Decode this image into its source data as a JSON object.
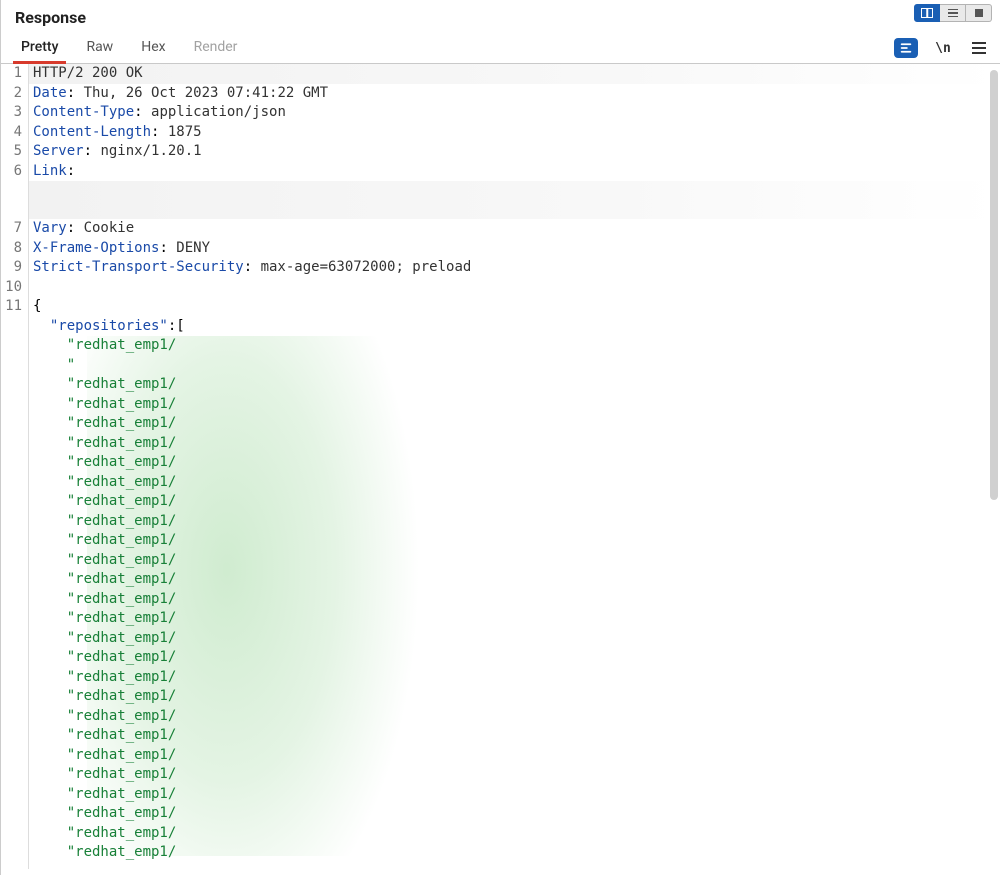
{
  "panel_title": "Response",
  "tabs": {
    "pretty": "Pretty",
    "raw": "Raw",
    "hex": "Hex",
    "render": "Render"
  },
  "toolbar": {
    "wrap_label": "\\n"
  },
  "gutter": [
    "1",
    "2",
    "3",
    "4",
    "5",
    "6",
    "",
    "7",
    "8",
    "9",
    "10",
    "11"
  ],
  "headers": {
    "status": "HTTP/2 200 OK",
    "date_k": "Date",
    "date_v": "Thu, 26 Oct 2023 07:41:22 GMT",
    "ctype_k": "Content-Type",
    "ctype_v": "application/json",
    "clen_k": "Content-Length",
    "clen_v": "1875",
    "server_k": "Server",
    "server_v": "nginx/1.20.1",
    "link_k": "Link",
    "link_v": "",
    "vary_k": "Vary",
    "vary_v": "Cookie",
    "xfo_k": "X-Frame-Options",
    "xfo_v": "DENY",
    "hsts_k": "Strict-Transport-Security",
    "hsts_v": "max-age=63072000; preload"
  },
  "body": {
    "open_brace": "{",
    "repos_key": "\"repositories\"",
    "open_arr": ":[",
    "items": [
      "\"redhat_emp1/",
      "\"",
      "\"redhat_emp1/",
      "\"redhat_emp1/",
      "\"redhat_emp1/",
      "\"redhat_emp1/",
      "\"redhat_emp1/",
      "\"redhat_emp1/",
      "\"redhat_emp1/",
      "\"redhat_emp1/",
      "\"redhat_emp1/",
      "\"redhat_emp1/",
      "\"redhat_emp1/",
      "\"redhat_emp1/",
      "\"redhat_emp1/",
      "\"redhat_emp1/",
      "\"redhat_emp1/",
      "\"redhat_emp1/",
      "\"redhat_emp1/",
      "\"redhat_emp1/",
      "\"redhat_emp1/",
      "\"redhat_emp1/",
      "\"redhat_emp1/",
      "\"redhat_emp1/",
      "\"redhat_emp1/",
      "\"redhat_emp1/",
      "\"redhat_emp1/"
    ]
  }
}
